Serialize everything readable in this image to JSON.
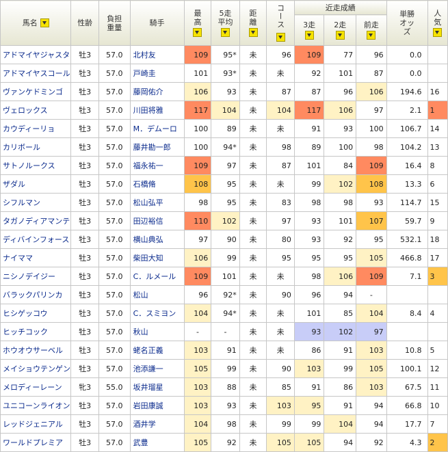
{
  "header": {
    "horse_name": "馬名",
    "sex_age": "性齢",
    "weight": "負担重量",
    "jockey": "騎手",
    "best": "最高",
    "avg5": "5走平均",
    "distance": "距離",
    "course": "コース",
    "recent_group": "近走成績",
    "r3": "3走",
    "r2": "2走",
    "r1": "前走",
    "odds": "単勝オッズ",
    "popularity": "人気"
  },
  "colors": {
    "red": "#ff8a60",
    "orange": "#ffc44a",
    "yellow": "#fff2c4",
    "blue": "#c8cdf8"
  },
  "rows": [
    {
      "name": "アドマイヤジャスタ",
      "sex": "牡3",
      "wt": "57.0",
      "jockey": "北村友",
      "best": "109",
      "avg": "95*",
      "dist": "未",
      "course": "96",
      "r3": "109",
      "r2": "77",
      "r1": "96",
      "odds": "0.0",
      "pop": ""
    },
    {
      "name": "アドマイヤスコール",
      "sex": "牡3",
      "wt": "57.0",
      "jockey": "戸崎圭",
      "best": "101",
      "avg": "93*",
      "dist": "未",
      "course": "未",
      "r3": "92",
      "r2": "101",
      "r1": "87",
      "odds": "0.0",
      "pop": ""
    },
    {
      "name": "ヴァンケドミンゴ",
      "sex": "牡3",
      "wt": "57.0",
      "jockey": "藤岡佑介",
      "best": "106",
      "avg": "93",
      "dist": "未",
      "course": "87",
      "r3": "87",
      "r2": "96",
      "r1": "106",
      "odds": "194.6",
      "pop": "16"
    },
    {
      "name": "ヴェロックス",
      "sex": "牡3",
      "wt": "57.0",
      "jockey": "川田将雅",
      "best": "117",
      "avg": "104",
      "dist": "未",
      "course": "104",
      "r3": "117",
      "r2": "106",
      "r1": "97",
      "odds": "2.1",
      "pop": "1"
    },
    {
      "name": "カウディーリョ",
      "sex": "牡3",
      "wt": "57.0",
      "jockey": "M．デムーロ",
      "best": "100",
      "avg": "89",
      "dist": "未",
      "course": "未",
      "r3": "91",
      "r2": "93",
      "r1": "100",
      "odds": "106.7",
      "pop": "14"
    },
    {
      "name": "カリボール",
      "sex": "牡3",
      "wt": "57.0",
      "jockey": "藤井勘一郎",
      "best": "100",
      "avg": "94*",
      "dist": "未",
      "course": "98",
      "r3": "89",
      "r2": "100",
      "r1": "98",
      "odds": "104.2",
      "pop": "13"
    },
    {
      "name": "サトノルークス",
      "sex": "牡3",
      "wt": "57.0",
      "jockey": "福永祐一",
      "best": "109",
      "avg": "97",
      "dist": "未",
      "course": "87",
      "r3": "101",
      "r2": "84",
      "r1": "109",
      "odds": "16.4",
      "pop": "8"
    },
    {
      "name": "ザダル",
      "sex": "牡3",
      "wt": "57.0",
      "jockey": "石橋脩",
      "best": "108",
      "avg": "95",
      "dist": "未",
      "course": "未",
      "r3": "99",
      "r2": "102",
      "r1": "108",
      "odds": "13.3",
      "pop": "6"
    },
    {
      "name": "シフルマン",
      "sex": "牡3",
      "wt": "57.0",
      "jockey": "松山弘平",
      "best": "98",
      "avg": "95",
      "dist": "未",
      "course": "83",
      "r3": "98",
      "r2": "98",
      "r1": "93",
      "odds": "114.7",
      "pop": "15"
    },
    {
      "name": "タガノディアマンテ",
      "sex": "牡3",
      "wt": "57.0",
      "jockey": "田辺裕信",
      "best": "110",
      "avg": "102",
      "dist": "未",
      "course": "97",
      "r3": "93",
      "r2": "101",
      "r1": "107",
      "odds": "59.7",
      "pop": "9"
    },
    {
      "name": "ディバインフォース",
      "sex": "牡3",
      "wt": "57.0",
      "jockey": "横山典弘",
      "best": "97",
      "avg": "90",
      "dist": "未",
      "course": "80",
      "r3": "93",
      "r2": "92",
      "r1": "95",
      "odds": "532.1",
      "pop": "18"
    },
    {
      "name": "ナイママ",
      "sex": "牡3",
      "wt": "57.0",
      "jockey": "柴田大知",
      "best": "106",
      "avg": "99",
      "dist": "未",
      "course": "95",
      "r3": "95",
      "r2": "95",
      "r1": "105",
      "odds": "466.8",
      "pop": "17"
    },
    {
      "name": "ニシノデイジー",
      "sex": "牡3",
      "wt": "57.0",
      "jockey": "C．ルメール",
      "best": "109",
      "avg": "101",
      "dist": "未",
      "course": "未",
      "r3": "98",
      "r2": "106",
      "r1": "109",
      "odds": "7.1",
      "pop": "3"
    },
    {
      "name": "バラックパリンカ",
      "sex": "牡3",
      "wt": "57.0",
      "jockey": "松山",
      "best": "96",
      "avg": "92*",
      "dist": "未",
      "course": "90",
      "r3": "96",
      "r2": "94",
      "r1": "-",
      "odds": "",
      "pop": ""
    },
    {
      "name": "ヒシゲッコウ",
      "sex": "牡3",
      "wt": "57.0",
      "jockey": "C．スミヨン",
      "best": "104",
      "avg": "94*",
      "dist": "未",
      "course": "未",
      "r3": "101",
      "r2": "85",
      "r1": "104",
      "odds": "8.4",
      "pop": "4"
    },
    {
      "name": "ヒッチコック",
      "sex": "牡3",
      "wt": "57.0",
      "jockey": "秋山",
      "best": "-",
      "avg": "-",
      "dist": "未",
      "course": "未",
      "r3": "93",
      "r2": "102",
      "r1": "97",
      "odds": "",
      "pop": ""
    },
    {
      "name": "ホウオウサーベル",
      "sex": "牡3",
      "wt": "57.0",
      "jockey": "蛯名正義",
      "best": "103",
      "avg": "91",
      "dist": "未",
      "course": "未",
      "r3": "86",
      "r2": "91",
      "r1": "103",
      "odds": "10.8",
      "pop": "5"
    },
    {
      "name": "メイショウテンゲン",
      "sex": "牡3",
      "wt": "57.0",
      "jockey": "池添謙一",
      "best": "105",
      "avg": "99",
      "dist": "未",
      "course": "90",
      "r3": "103",
      "r2": "99",
      "r1": "105",
      "odds": "100.1",
      "pop": "12"
    },
    {
      "name": "メロディーレーン",
      "sex": "牝3",
      "wt": "55.0",
      "jockey": "坂井瑠星",
      "best": "103",
      "avg": "88",
      "dist": "未",
      "course": "85",
      "r3": "91",
      "r2": "86",
      "r1": "103",
      "odds": "67.5",
      "pop": "11"
    },
    {
      "name": "ユニコーンライオン",
      "sex": "牡3",
      "wt": "57.0",
      "jockey": "岩田康誠",
      "best": "103",
      "avg": "93",
      "dist": "未",
      "course": "103",
      "r3": "95",
      "r2": "91",
      "r1": "94",
      "odds": "66.8",
      "pop": "10"
    },
    {
      "name": "レッドジェニアル",
      "sex": "牡3",
      "wt": "57.0",
      "jockey": "酒井学",
      "best": "104",
      "avg": "98",
      "dist": "未",
      "course": "99",
      "r3": "99",
      "r2": "104",
      "r1": "94",
      "odds": "17.7",
      "pop": "7"
    },
    {
      "name": "ワールドプレミア",
      "sex": "牡3",
      "wt": "57.0",
      "jockey": "武豊",
      "best": "105",
      "avg": "92",
      "dist": "未",
      "course": "105",
      "r3": "105",
      "r2": "94",
      "r1": "92",
      "odds": "4.3",
      "pop": "2"
    }
  ],
  "highlights": [
    {
      "best": "red",
      "r3": "red"
    },
    {},
    {
      "best": "yel",
      "r1": "yel"
    },
    {
      "best": "red",
      "avg": "yel",
      "course": "yel",
      "r3": "red",
      "r2": "yel",
      "pop": "red"
    },
    {},
    {},
    {
      "best": "red",
      "r1": "red"
    },
    {
      "best": "org",
      "r2": "yel",
      "r1": "org"
    },
    {},
    {
      "best": "red",
      "avg": "yel",
      "r1": "org"
    },
    {},
    {
      "best": "yel",
      "r1": "yel"
    },
    {
      "best": "red",
      "r2": "yel",
      "r1": "red",
      "pop": "org"
    },
    {},
    {
      "best": "yel",
      "r1": "yel"
    },
    {
      "r3": "blu",
      "r2": "blu",
      "r1": "blu"
    },
    {
      "best": "yel",
      "r1": "yel"
    },
    {
      "best": "yel",
      "r3": "yel",
      "r1": "yel"
    },
    {
      "best": "yel",
      "r1": "yel"
    },
    {
      "best": "yel",
      "course": "yel",
      "r3": "yel"
    },
    {
      "best": "yel",
      "r2": "yel"
    },
    {
      "best": "yel",
      "course": "yel",
      "r3": "yel",
      "pop": "org"
    }
  ]
}
